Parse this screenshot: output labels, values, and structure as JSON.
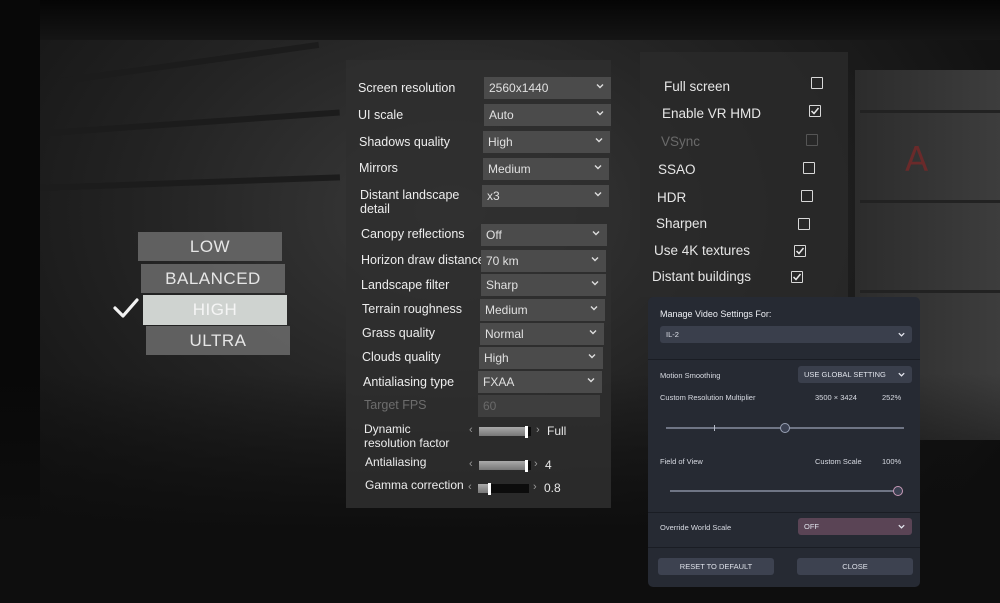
{
  "presets": {
    "items": [
      "LOW",
      "BALANCED",
      "HIGH",
      "ULTRA"
    ],
    "selected": "HIGH"
  },
  "settings": {
    "screen_resolution": {
      "label": "Screen resolution",
      "value": "2560x1440"
    },
    "ui_scale": {
      "label": "UI scale",
      "value": "Auto"
    },
    "shadows_quality": {
      "label": "Shadows quality",
      "value": "High"
    },
    "mirrors": {
      "label": "Mirrors",
      "value": "Medium"
    },
    "distant_landscape": {
      "label": "Distant landscape detail",
      "value": "x3"
    },
    "canopy_reflections": {
      "label": "Canopy reflections",
      "value": "Off"
    },
    "horizon_draw_distance": {
      "label": "Horizon draw distance",
      "value": "70 km"
    },
    "landscape_filter": {
      "label": "Landscape filter",
      "value": "Sharp"
    },
    "terrain_roughness": {
      "label": "Terrain roughness",
      "value": "Medium"
    },
    "grass_quality": {
      "label": "Grass quality",
      "value": "Normal"
    },
    "clouds_quality": {
      "label": "Clouds quality",
      "value": "High"
    },
    "antialiasing_type": {
      "label": "Antialiasing type",
      "value": "FXAA"
    },
    "target_fps": {
      "label": "Target FPS",
      "value": "60"
    },
    "dynamic_resolution": {
      "label": "Dynamic resolution factor",
      "value": "Full",
      "level": 0.95
    },
    "antialiasing": {
      "label": "Antialiasing",
      "value": "4",
      "level": 0.95
    },
    "gamma_correction": {
      "label": "Gamma correction",
      "value": "0.8",
      "level": 0.25
    }
  },
  "toggles": {
    "full_screen": {
      "label": "Full screen",
      "checked": false
    },
    "enable_vr_hmd": {
      "label": "Enable VR HMD",
      "checked": true
    },
    "vsync": {
      "label": "VSync",
      "checked": false,
      "disabled": true
    },
    "ssao": {
      "label": "SSAO",
      "checked": false
    },
    "hdr": {
      "label": "HDR",
      "checked": false
    },
    "sharpen": {
      "label": "Sharpen",
      "checked": false
    },
    "use_4k_textures": {
      "label": "Use 4K textures",
      "checked": true
    },
    "distant_buildings": {
      "label": "Distant buildings",
      "checked": true
    }
  },
  "vr_overlay": {
    "title": "Manage Video Settings For:",
    "app_select": "IL-2",
    "motion_smoothing_label": "Motion Smoothing",
    "motion_smoothing_value": "USE GLOBAL SETTING",
    "custom_res_label": "Custom Resolution Multiplier",
    "custom_res_size": "3500 × 3424",
    "custom_res_percent": "252%",
    "custom_res_level": 0.5,
    "fov_label": "Field of View",
    "fov_mode": "Custom Scale",
    "fov_percent": "100%",
    "fov_level": 1.0,
    "world_scale_label": "Override World Scale",
    "world_scale_value": "OFF",
    "reset_button": "RESET TO DEFAULT",
    "close_button": "CLOSE",
    "accent_pink": "#c89ab8"
  }
}
